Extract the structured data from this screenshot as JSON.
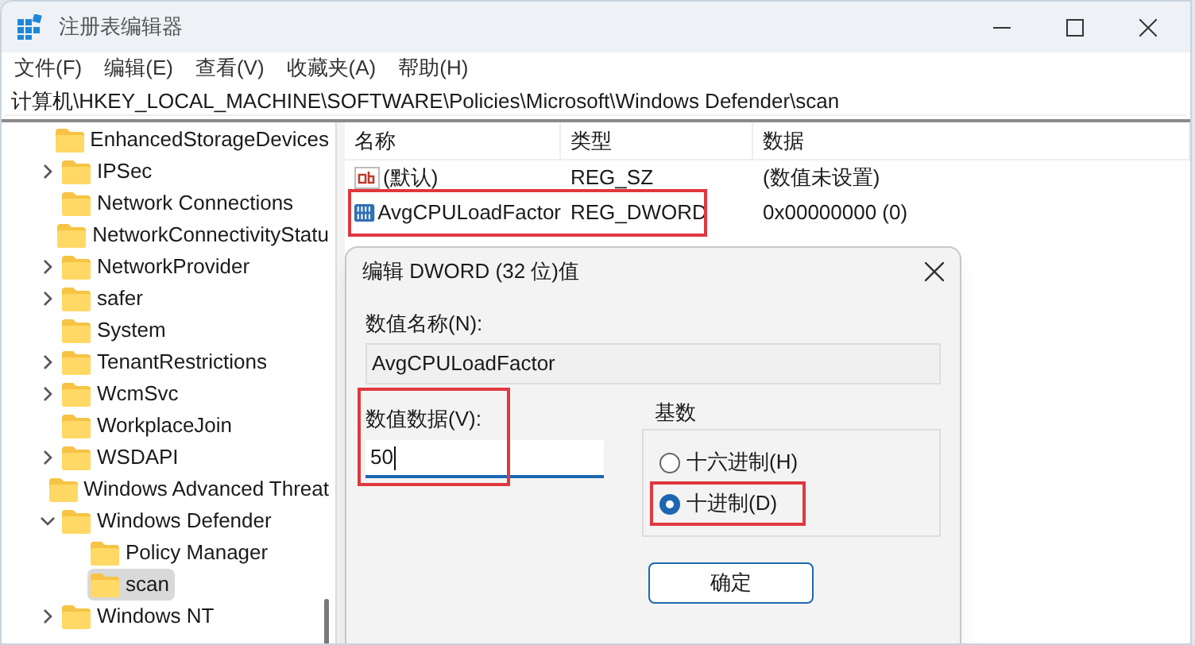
{
  "window": {
    "title": "注册表编辑器"
  },
  "menu": [
    "文件(F)",
    "编辑(E)",
    "查看(V)",
    "收藏夹(A)",
    "帮助(H)"
  ],
  "address": "计算机\\HKEY_LOCAL_MACHINE\\SOFTWARE\\Policies\\Microsoft\\Windows Defender\\scan",
  "tree": [
    {
      "children": [
        {
          "label": "EnhancedStorageDevices",
          "has_children": false,
          "selected": false
        },
        {
          "label": "IPSec",
          "has_children": true,
          "selected": false
        },
        {
          "label": "Network Connections",
          "has_children": false,
          "selected": false
        },
        {
          "label": "NetworkConnectivityStatu",
          "has_children": false,
          "selected": false
        },
        {
          "label": "NetworkProvider",
          "has_children": true,
          "selected": false
        },
        {
          "label": "safer",
          "has_children": true,
          "selected": false
        },
        {
          "label": "System",
          "has_children": false,
          "selected": false
        },
        {
          "label": "TenantRestrictions",
          "has_children": true,
          "selected": false
        },
        {
          "label": "WcmSvc",
          "has_children": true,
          "selected": false
        },
        {
          "label": "WorkplaceJoin",
          "has_children": false,
          "selected": false
        },
        {
          "label": "WSDAPI",
          "has_children": true,
          "selected": false
        }
      ]
    },
    {
      "label": "Windows Advanced Threat",
      "has_children": false,
      "selected": false
    },
    {
      "label": "Windows Defender",
      "has_children": true,
      "expanded": true,
      "selected": false,
      "children": [
        {
          "label": "Policy Manager",
          "has_children": false,
          "selected": false
        },
        {
          "label": "scan",
          "has_children": false,
          "selected": true
        }
      ]
    },
    {
      "label": "Windows NT",
      "has_children": true,
      "expanded": false,
      "selected": false
    }
  ],
  "list": {
    "columns": [
      "名称",
      "类型",
      "数据"
    ],
    "rows": [
      {
        "kind": "string",
        "name": "(默认)",
        "type": "REG_SZ",
        "data": "(数值未设置)",
        "highlighted": false
      },
      {
        "kind": "binary",
        "name": "AvgCPULoadFactor",
        "type": "REG_DWORD",
        "data": "0x00000000 (0)",
        "highlighted": true
      }
    ]
  },
  "dialog": {
    "title": "编辑 DWORD (32 位)值",
    "name_label": "数值名称(N):",
    "name_value": "AvgCPULoadFactor",
    "data_label": "数值数据(V):",
    "data_value": "50",
    "data_highlighted": true,
    "base_label": "基数",
    "bases": [
      {
        "label": "十六进制(H)",
        "selected": false,
        "highlighted": false
      },
      {
        "label": "十进制(D)",
        "selected": true,
        "highlighted": true
      }
    ],
    "buttons": [
      "确定"
    ]
  }
}
